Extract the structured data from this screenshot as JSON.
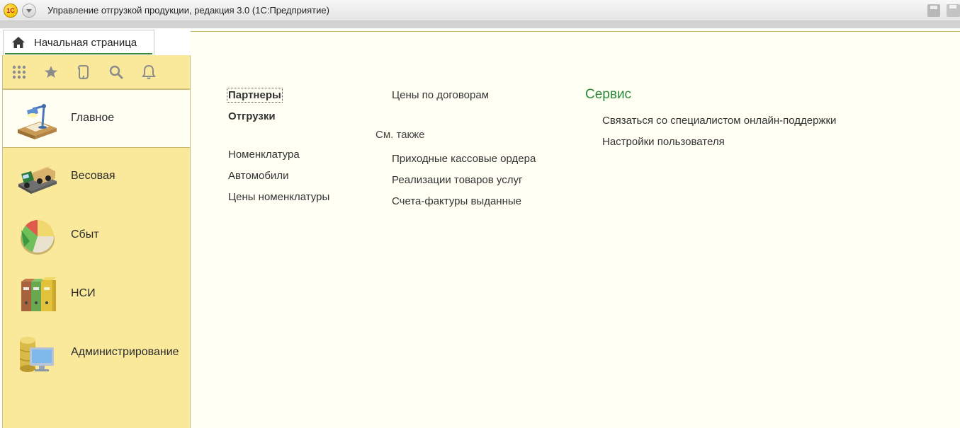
{
  "window": {
    "logo_text": "1С",
    "title": "Управление отгрузкой продукции, редакция 3.0  (1С:Предприятие)"
  },
  "tab": {
    "label": "Начальная страница"
  },
  "toolbar": {
    "items": [
      "apps-grid-icon",
      "star-icon",
      "history-icon",
      "search-icon",
      "bell-icon"
    ]
  },
  "sidebar": {
    "sections": [
      {
        "label": "Главное",
        "icon": "desk-lamp-icon",
        "active": true
      },
      {
        "label": "Весовая",
        "icon": "truck-scale-icon",
        "active": false
      },
      {
        "label": "Сбыт",
        "icon": "pie-chart-icon",
        "active": false
      },
      {
        "label": "НСИ",
        "icon": "binders-icon",
        "active": false
      },
      {
        "label": "Администрирование",
        "icon": "database-monitor-icon",
        "active": false
      }
    ]
  },
  "main": {
    "column1": {
      "bold_links": [
        "Партнеры",
        "Отгрузки"
      ],
      "links": [
        "Номенклатура",
        "Автомобили",
        "Цены номенклатуры"
      ]
    },
    "column2": {
      "links_top": [
        "Цены по договорам"
      ],
      "see_also_title": "См. также",
      "see_also_links": [
        "Приходные кассовые ордера",
        "Реализации товаров услуг",
        "Счета-фактуры выданные"
      ]
    },
    "service": {
      "title": "Сервис",
      "links": [
        "Связаться со специалистом онлайн-поддержки",
        "Настройки пользователя"
      ]
    }
  },
  "colors": {
    "sidebar_bg": "#fbe99b",
    "main_bg": "#fffff4",
    "service_title": "#2a8a3a",
    "tab_underline": "#3c8a3c"
  }
}
